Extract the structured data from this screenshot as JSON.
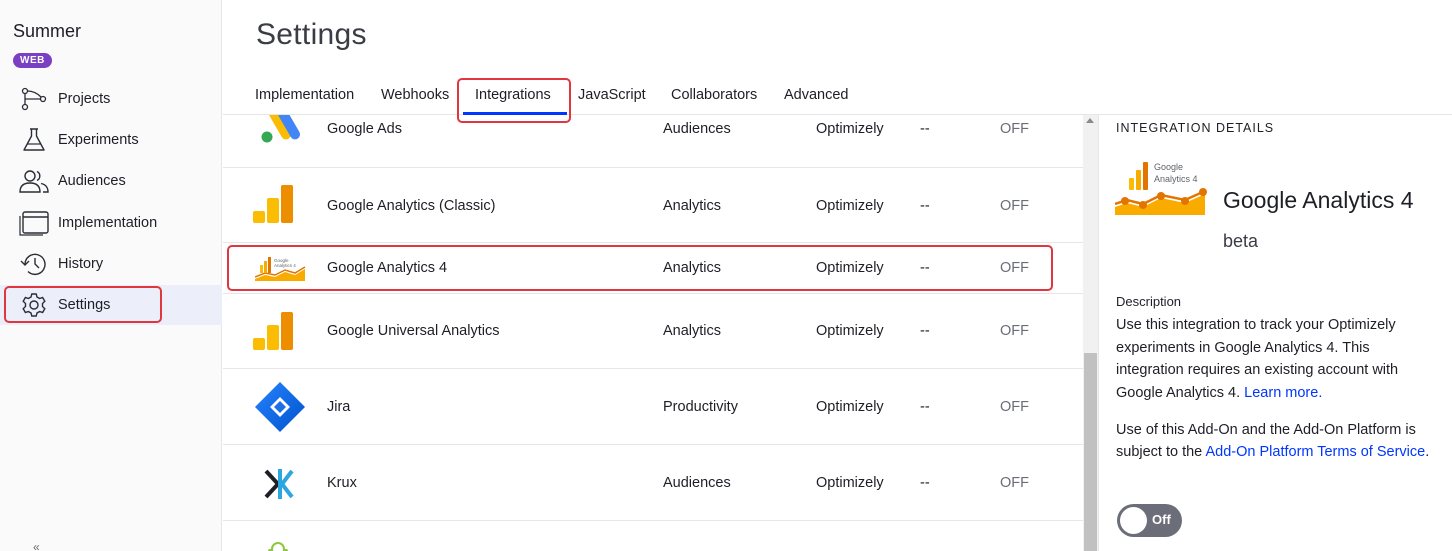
{
  "project": {
    "name": "Summer",
    "badge": "WEB"
  },
  "sidebar": {
    "items": [
      {
        "label": "Projects",
        "icon": "projects-icon"
      },
      {
        "label": "Experiments",
        "icon": "flask-icon"
      },
      {
        "label": "Audiences",
        "icon": "people-icon"
      },
      {
        "label": "Implementation",
        "icon": "window-icon"
      },
      {
        "label": "History",
        "icon": "history-icon"
      },
      {
        "label": "Settings",
        "icon": "gear-icon",
        "active": true
      }
    ]
  },
  "page": {
    "title": "Settings"
  },
  "tabs": [
    {
      "label": "Implementation"
    },
    {
      "label": "Webhooks"
    },
    {
      "label": "Integrations",
      "active": true
    },
    {
      "label": "JavaScript"
    },
    {
      "label": "Collaborators"
    },
    {
      "label": "Advanced"
    }
  ],
  "integrations": [
    {
      "name": "Google Ads",
      "category": "Audiences",
      "owner": "Optimizely",
      "extra": "--",
      "status": "OFF",
      "icon": "google-ads-icon"
    },
    {
      "name": "Google Analytics (Classic)",
      "category": "Analytics",
      "owner": "Optimizely",
      "extra": "--",
      "status": "OFF",
      "icon": "google-analytics-icon"
    },
    {
      "name": "Google Analytics 4",
      "category": "Analytics",
      "owner": "Optimizely",
      "extra": "--",
      "status": "OFF",
      "icon": "google-analytics-4-icon",
      "selected": true
    },
    {
      "name": "Google Universal Analytics",
      "category": "Analytics",
      "owner": "Optimizely",
      "extra": "--",
      "status": "OFF",
      "icon": "google-analytics-icon"
    },
    {
      "name": "Jira",
      "category": "Productivity",
      "owner": "Optimizely",
      "extra": "--",
      "status": "OFF",
      "icon": "jira-icon"
    },
    {
      "name": "Krux",
      "category": "Audiences",
      "owner": "Optimizely",
      "extra": "--",
      "status": "OFF",
      "icon": "krux-icon"
    }
  ],
  "details": {
    "heading": "INTEGRATION DETAILS",
    "logo_text_line1": "Google",
    "logo_text_line2": "Analytics 4",
    "name": "Google Analytics 4",
    "tag": "beta",
    "description_label": "Description",
    "description": "Use this integration to track your Optimizely experiments in Google Analytics 4. This integration requires an existing account with Google Analytics 4.",
    "learn_more": "Learn more.",
    "terms_prefix": "Use of this Add-On and the Add-On Platform is subject to the",
    "terms_link": "Add-On Platform Terms of Service",
    "terms_suffix": ".",
    "toggle_label": "Off"
  },
  "colors": {
    "accent": "#0037ff",
    "badge": "#7a3fc2",
    "highlight_box": "#e0373f",
    "ga_orange": "#f9ab00",
    "ga_dark_orange": "#e37400"
  }
}
